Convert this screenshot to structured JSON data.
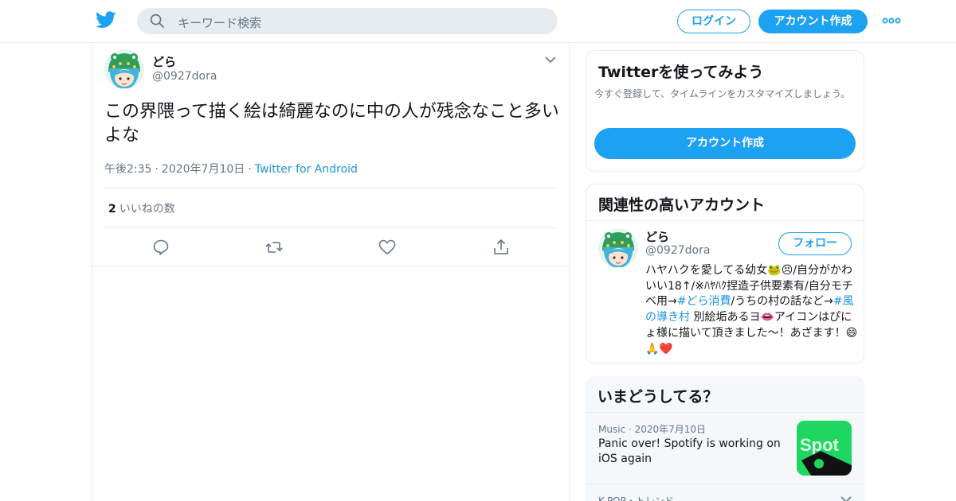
{
  "header": {
    "search_placeholder": "キーワード検索",
    "login_label": "ログイン",
    "signup_label": "アカウント作成",
    "brand_color": "#1da1f2"
  },
  "tweet": {
    "author_name": "どら",
    "author_handle": "@0927dora",
    "text": "この界隈って描く絵は綺麗なのに中の人が残念なこと多いよな",
    "time": "午後2:35",
    "date": "2020年7月10日",
    "source": "Twitter for Android",
    "likes_count": "2",
    "likes_label": "いいねの数",
    "action_icons": [
      "reply-icon",
      "retweet-icon",
      "like-icon",
      "share-icon"
    ]
  },
  "sidebar": {
    "signup_card": {
      "title": "Twitterを使ってみよう",
      "description": "今すぐ登録して、タイムラインをカスタマイズしましょう。",
      "button_label": "アカウント作成"
    },
    "related_card": {
      "title": "関連性の高いアカウント",
      "account": {
        "name": "どら",
        "handle": "@0927dora",
        "follow_label": "フォロー",
        "bio_part1": "ハヤハクを愛してる幼女🐸😣/自分がかわいい18↑/※ﾊﾔﾊｸ捏造子供要素有/自分モチベ用→",
        "bio_hashtag1": "#どら消費",
        "bio_part2": "/うちの村の話など→",
        "bio_hashtag2": "#風の導き村",
        "bio_part3": " 別絵垢あるヨ👄アイコンはぴにょ様に描いて頂きました〜！あざます！😄🙏❤️"
      }
    },
    "trends_card": {
      "title": "いまどうしてる？",
      "item1": {
        "category": "Music",
        "date": "2020年7月10日",
        "title": "Panic over! Spotify is working on iOS again",
        "thumb_text": "Spot"
      },
      "item2": {
        "meta": "K-POP・トレンド"
      }
    }
  }
}
